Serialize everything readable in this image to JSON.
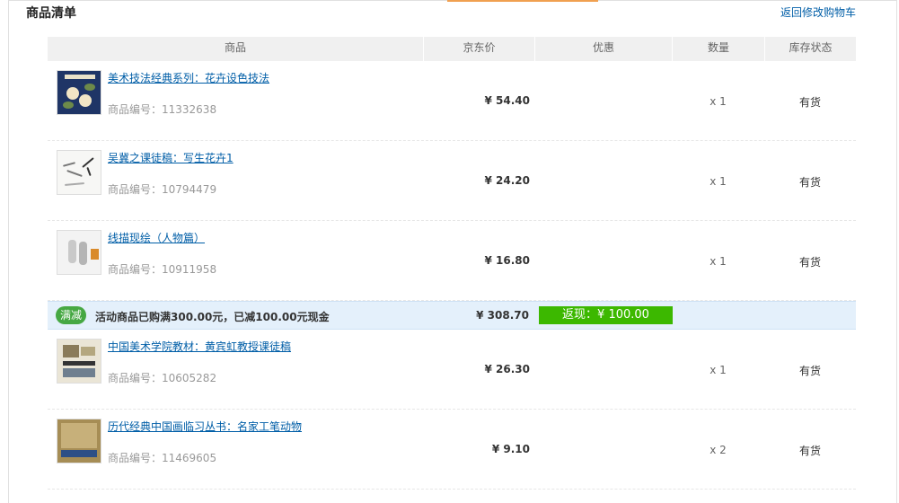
{
  "page": {
    "title": "商品清单",
    "back_link": "返回修改购物车"
  },
  "table": {
    "headers": [
      "商品",
      "京东价",
      "优惠",
      "数量",
      "库存状态"
    ]
  },
  "items_group1": [
    {
      "name": "美术技法经典系列：花卉设色技法",
      "sku": "商品编号：11332638",
      "price": "¥ 54.40",
      "qty": "x 1",
      "stock": "有货"
    },
    {
      "name": "吴冀之课徒稿：写生花卉1",
      "sku": "商品编号：10794479",
      "price": "¥ 24.20",
      "qty": "x 1",
      "stock": "有货"
    },
    {
      "name": "线描现绘（人物篇）",
      "sku": "商品编号：10911958",
      "price": "¥ 16.80",
      "qty": "x 1",
      "stock": "有货"
    }
  ],
  "promotion": {
    "badge": "满减",
    "text": "活动商品已购满300.00元，已减100.00元现金",
    "total": "¥ 308.70",
    "rebate": "返现：¥ 100.00"
  },
  "items_group2": [
    {
      "name": "中国美术学院教材：黄宾虹教授课徒稿",
      "sku": "商品编号：10605282",
      "price": "¥ 26.30",
      "qty": "x 1",
      "stock": "有货"
    },
    {
      "name": "历代经典中国画临习丛书：名家工笔动物",
      "sku": "商品编号：11469605",
      "price": "¥ 9.10",
      "qty": "x 2",
      "stock": "有货"
    }
  ],
  "colors": {
    "link": "#005ea7",
    "promo_bg": "#e4f0fb",
    "badge": "#46a843",
    "rebate": "#3cb800",
    "header_bg": "#f0f0f0"
  }
}
